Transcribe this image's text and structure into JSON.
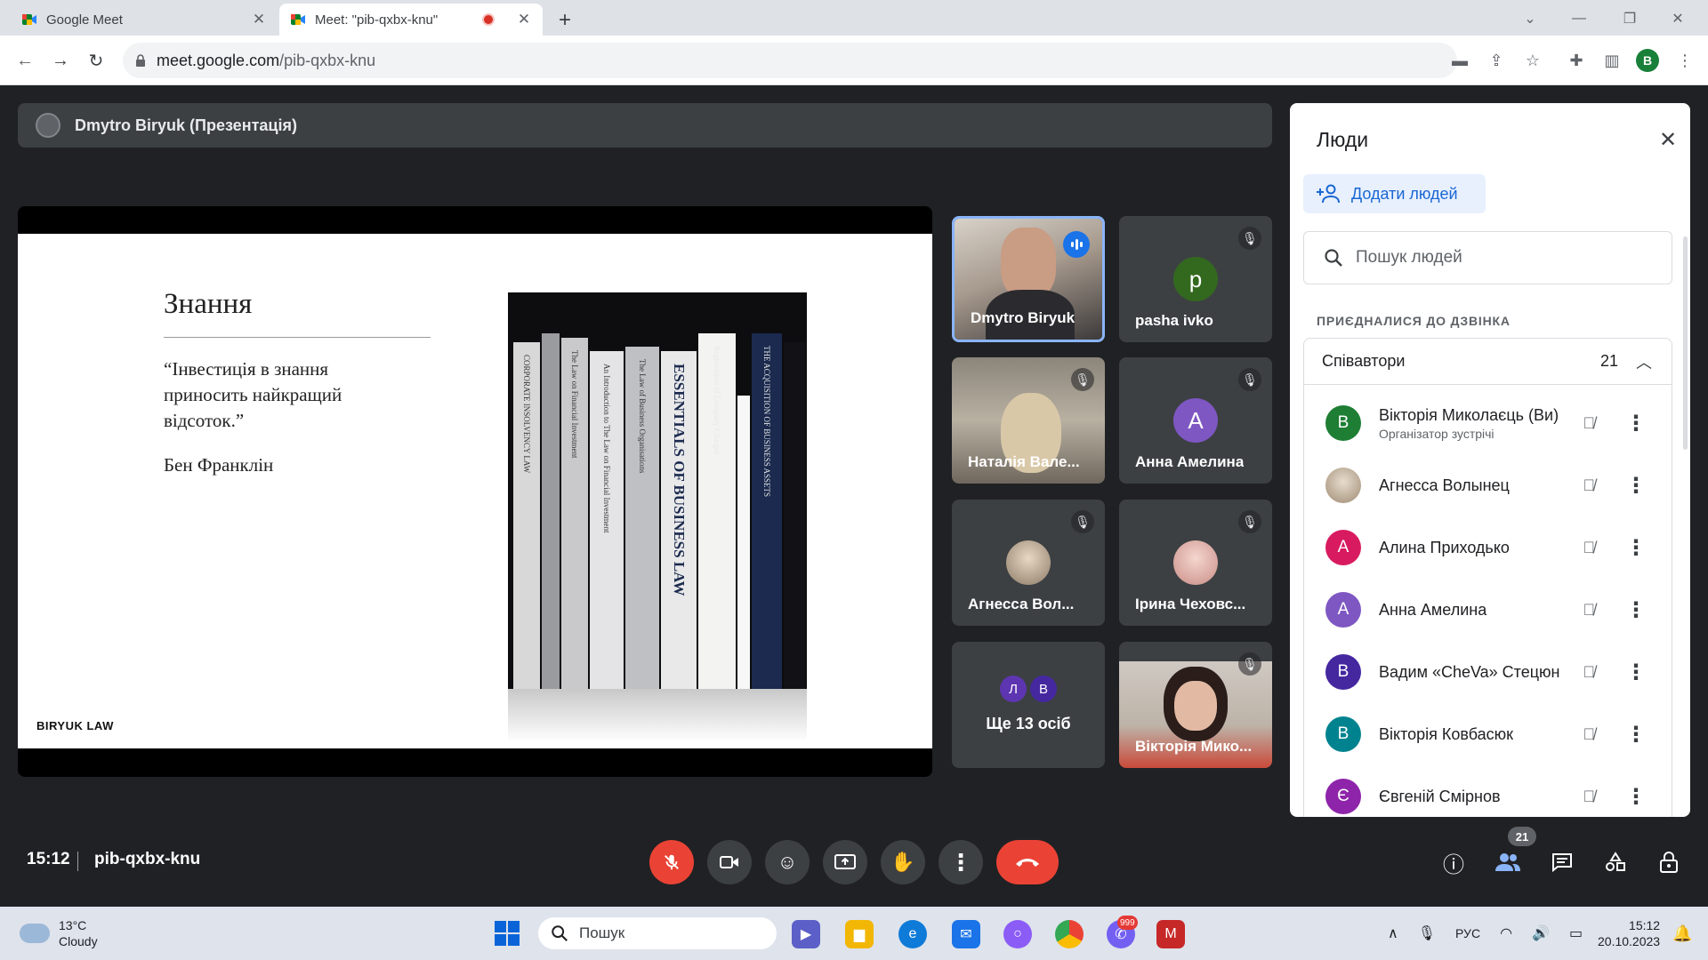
{
  "browser": {
    "tabs": [
      {
        "label": "Google Meet",
        "close": "✕"
      },
      {
        "label": "Meet: \"pib-qxbx-knu\"",
        "close": "✕"
      }
    ],
    "new_tab": "+",
    "window_controls": [
      "⌄",
      "—",
      "❐",
      "✕"
    ],
    "url_domain": "meet.google.com",
    "url_path": "/pib-qxbx-knu",
    "profile_initial": "B"
  },
  "meet": {
    "presenter_label": "Dmytro Biryuk (Презентація)",
    "slide": {
      "title": "Знання",
      "quote": "“Інвестиція в знання приносить найкращий відсоток.”",
      "author": "Бен Франклін",
      "brand": "BIRYUK LAW",
      "book_spines": [
        "CORPORATE INSOLVENCY LAW",
        "The Law on Financial Investment",
        "An Introduction to The Law on Financial Investment",
        "The Law of Business Organisations",
        "ESSENTIALS OF BUSINESS LAW",
        "Registration of Company Charges",
        "THE ACQUISITION OF BUSINESS ASSETS"
      ]
    },
    "tiles": [
      {
        "name": "Dmytro Biryuk",
        "type": "video"
      },
      {
        "name": "pasha ivko",
        "initial": "p",
        "color": "#33691e"
      },
      {
        "name": "Наталія Вале...",
        "type": "video"
      },
      {
        "name": "Анна Амелина",
        "initial": "А",
        "color": "#7e57c2"
      },
      {
        "name": "Агнесса Вол...",
        "type": "photo"
      },
      {
        "name": "Ірина Чеховс...",
        "type": "photo"
      },
      {
        "more_label": "Ще 13 осіб",
        "initials": [
          "Л",
          "В"
        ]
      },
      {
        "name": "Вікторія Мико...",
        "type": "video"
      }
    ],
    "clock": "15:12",
    "meeting_code": "pib-qxbx-knu",
    "people_badge": "21"
  },
  "people_panel": {
    "title": "Люди",
    "add_label": "Додати людей",
    "search_placeholder": "Пошук людей",
    "joined_label": "ПРИЄДНАЛИСЯ ДО ДЗВІНКА",
    "group_label": "Співавтори",
    "group_count": "21",
    "participants": [
      {
        "name": "Вікторія Миколаєць (Ви)",
        "sub": "Організатор зустрічі",
        "initial": "В",
        "color": "#1e7e34"
      },
      {
        "name": "Агнесса Волынец",
        "initial": "",
        "color": "#b9a78e"
      },
      {
        "name": "Алина Приходько",
        "initial": "А",
        "color": "#d81b60"
      },
      {
        "name": "Анна Амелина",
        "initial": "А",
        "color": "#7e57c2"
      },
      {
        "name": "Вадим «CheVa» Стецюн",
        "initial": "В",
        "color": "#4527a0"
      },
      {
        "name": "Вікторія Ковбасюк",
        "initial": "В",
        "color": "#00838f"
      },
      {
        "name": "Євгеній Смірнов",
        "initial": "Є",
        "color": "#8e24aa"
      }
    ]
  },
  "taskbar": {
    "temperature": "13°C",
    "weather": "Cloudy",
    "search": "Пошук",
    "language": "РУС",
    "time": "15:12",
    "date": "20.10.2023",
    "badge": "999"
  },
  "colors": {
    "accent": "#1a73e8",
    "danger": "#ea4335",
    "meet_bg": "#202124",
    "tile": "#3c4043"
  }
}
